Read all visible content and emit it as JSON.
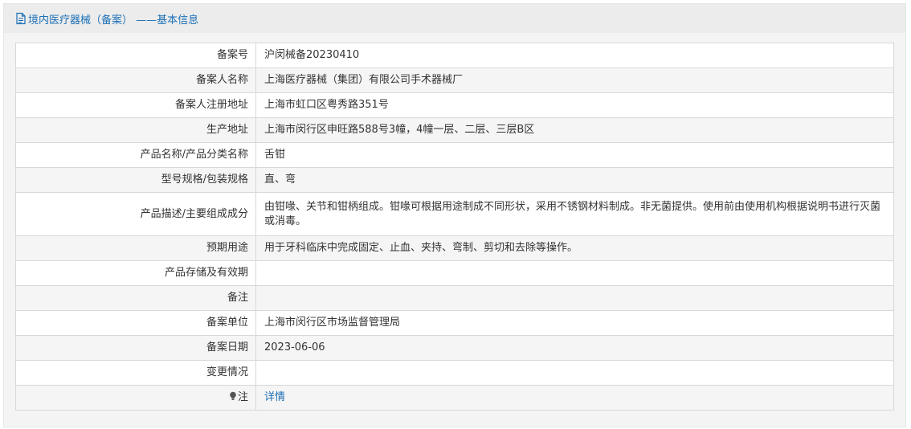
{
  "header": {
    "title": "境内医疗器械（备案） ——基本信息",
    "icon": "document-icon"
  },
  "rows": [
    {
      "label": "备案号",
      "value": "沪闵械备20230410"
    },
    {
      "label": "备案人名称",
      "value": "上海医疗器械（集团）有限公司手术器械厂"
    },
    {
      "label": "备案人注册地址",
      "value": "上海市虹口区粤秀路351号"
    },
    {
      "label": "生产地址",
      "value": "上海市闵行区申旺路588号3幢，4幢一层、二层、三层B区"
    },
    {
      "label": "产品名称/产品分类名称",
      "value": "舌钳"
    },
    {
      "label": "型号规格/包装规格",
      "value": "直、弯"
    },
    {
      "label": "产品描述/主要组成成分",
      "value": "由钳喙、关节和钳柄组成。钳喙可根据用途制成不同形状，采用不锈钢材料制成。非无菌提供。使用前由使用机构根据说明书进行灭菌或消毒。"
    },
    {
      "label": "预期用途",
      "value": "用于牙科临床中完成固定、止血、夹持、弯制、剪切和去除等操作。"
    },
    {
      "label": "产品存储及有效期",
      "value": ""
    },
    {
      "label": "备注",
      "value": ""
    },
    {
      "label": "备案单位",
      "value": "上海市闵行区市场监督管理局"
    },
    {
      "label": "备案日期",
      "value": "2023-06-06"
    },
    {
      "label": "变更情况",
      "value": ""
    },
    {
      "label": "注",
      "value": "详情",
      "icon": "lightbulb-icon"
    }
  ],
  "colors": {
    "accent": "#1a6fb6",
    "row_alt": "#f5f5f5",
    "border": "#d8d8d8"
  }
}
